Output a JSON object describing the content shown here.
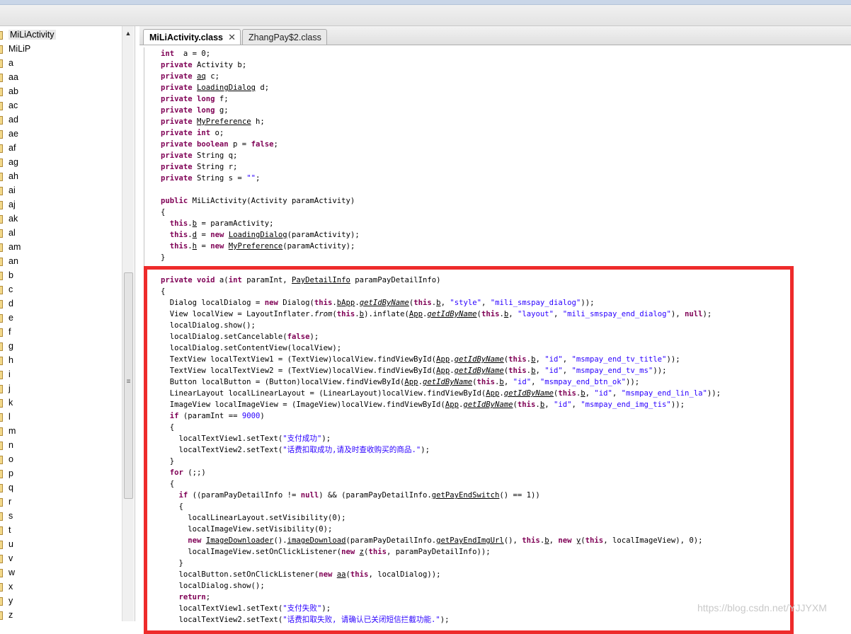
{
  "tree": {
    "items": [
      "MiLiActivity",
      "MiLiP",
      "a",
      "aa",
      "ab",
      "ac",
      "ad",
      "ae",
      "af",
      "ag",
      "ah",
      "ai",
      "aj",
      "ak",
      "al",
      "am",
      "an",
      "b",
      "c",
      "d",
      "e",
      "f",
      "g",
      "h",
      "i",
      "j",
      "k",
      "l",
      "m",
      "n",
      "o",
      "p",
      "q",
      "r",
      "s",
      "t",
      "u",
      "v",
      "w",
      "x",
      "y",
      "z"
    ],
    "selected": "MiLiActivity"
  },
  "tabs": [
    {
      "label": "MiLiActivity.class",
      "active": true
    },
    {
      "label": "ZhangPay$2.class",
      "active": false
    }
  ],
  "code_lines": [
    [
      [
        "kw",
        "int"
      ],
      [
        "",
        "  a = 0;"
      ]
    ],
    [
      [
        "kw",
        "private"
      ],
      [
        "",
        " Activity b;"
      ]
    ],
    [
      [
        "kw",
        "private"
      ],
      [
        "",
        " "
      ],
      [
        "ul",
        "aq"
      ],
      [
        "",
        " c;"
      ]
    ],
    [
      [
        "kw",
        "private"
      ],
      [
        "",
        " "
      ],
      [
        "ul",
        "LoadingDialog"
      ],
      [
        "",
        " d;"
      ]
    ],
    [
      [
        "kw",
        "private long"
      ],
      [
        "",
        " f;"
      ]
    ],
    [
      [
        "kw",
        "private long"
      ],
      [
        "",
        " g;"
      ]
    ],
    [
      [
        "kw",
        "private"
      ],
      [
        "",
        " "
      ],
      [
        "ul",
        "MyPreference"
      ],
      [
        "",
        " h;"
      ]
    ],
    [
      [
        "kw",
        "private int"
      ],
      [
        "",
        " o;"
      ]
    ],
    [
      [
        "kw",
        "private boolean"
      ],
      [
        "",
        " p = "
      ],
      [
        "kw",
        "false"
      ],
      [
        "",
        ";"
      ]
    ],
    [
      [
        "kw",
        "private"
      ],
      [
        "",
        " String q;"
      ]
    ],
    [
      [
        "kw",
        "private"
      ],
      [
        "",
        " String r;"
      ]
    ],
    [
      [
        "kw",
        "private"
      ],
      [
        "",
        " String s = "
      ],
      [
        "str",
        "\"\""
      ],
      [
        "",
        ";"
      ]
    ],
    [],
    [
      [
        "kw",
        "public"
      ],
      [
        "",
        " MiLiActivity(Activity paramActivity)"
      ]
    ],
    [
      [
        "",
        "{"
      ]
    ],
    [
      [
        "",
        "  "
      ],
      [
        "kw",
        "this"
      ],
      [
        "",
        "."
      ],
      [
        "ul",
        "b"
      ],
      [
        "",
        " = paramActivity;"
      ]
    ],
    [
      [
        "",
        "  "
      ],
      [
        "kw",
        "this"
      ],
      [
        "",
        "."
      ],
      [
        "ul",
        "d"
      ],
      [
        "",
        " = "
      ],
      [
        "kw",
        "new"
      ],
      [
        "",
        " "
      ],
      [
        "ul",
        "LoadingDialog"
      ],
      [
        "",
        "(paramActivity);"
      ]
    ],
    [
      [
        "",
        "  "
      ],
      [
        "kw",
        "this"
      ],
      [
        "",
        "."
      ],
      [
        "ul",
        "h"
      ],
      [
        "",
        " = "
      ],
      [
        "kw",
        "new"
      ],
      [
        "",
        " "
      ],
      [
        "ul",
        "MyPreference"
      ],
      [
        "",
        "(paramActivity);"
      ]
    ],
    [
      [
        "",
        "}"
      ]
    ],
    [],
    [
      [
        "kw",
        "private void"
      ],
      [
        "",
        " a("
      ],
      [
        "kw",
        "int"
      ],
      [
        "",
        " paramInt, "
      ],
      [
        "ul",
        "PayDetailInfo"
      ],
      [
        "",
        " paramPayDetailInfo)"
      ]
    ],
    [
      [
        "",
        "{"
      ]
    ],
    [
      [
        "",
        "  Dialog localDialog = "
      ],
      [
        "kw",
        "new"
      ],
      [
        "",
        " Dialog("
      ],
      [
        "kw",
        "this"
      ],
      [
        "",
        "."
      ],
      [
        "ul",
        "b"
      ],
      [
        ", "
      ],
      [
        "ul",
        "App"
      ],
      [
        "",
        "."
      ],
      [
        "ul it",
        "getIdByName"
      ],
      [
        "",
        "("
      ],
      [
        "kw",
        "this"
      ],
      [
        "",
        "."
      ],
      [
        "ul",
        "b"
      ],
      [
        "",
        ", "
      ],
      [
        "str",
        "\"style\""
      ],
      [
        "",
        ", "
      ],
      [
        "str",
        "\"mili_smspay_dialog\""
      ],
      [
        "",
        "));"
      ]
    ],
    [
      [
        "",
        "  View localView = LayoutInflater."
      ],
      [
        "it",
        "from"
      ],
      [
        "",
        "("
      ],
      [
        "kw",
        "this"
      ],
      [
        "",
        "."
      ],
      [
        "ul",
        "b"
      ],
      [
        "",
        ").inflate("
      ],
      [
        "ul",
        "App"
      ],
      [
        "",
        "."
      ],
      [
        "ul it",
        "getIdByName"
      ],
      [
        "",
        "("
      ],
      [
        "kw",
        "this"
      ],
      [
        "",
        "."
      ],
      [
        "ul",
        "b"
      ],
      [
        "",
        ", "
      ],
      [
        "str",
        "\"layout\""
      ],
      [
        "",
        ", "
      ],
      [
        "str",
        "\"mili_smspay_end_dialog\""
      ],
      [
        "",
        "), "
      ],
      [
        "kw",
        "null"
      ],
      [
        "",
        ");"
      ]
    ],
    [
      [
        "",
        "  localDialog.show();"
      ]
    ],
    [
      [
        "",
        "  localDialog.setCancelable("
      ],
      [
        "kw",
        "false"
      ],
      [
        "",
        ");"
      ]
    ],
    [
      [
        "",
        "  localDialog.setContentView(localView);"
      ]
    ],
    [
      [
        "",
        "  TextView localTextView1 = (TextView)localView.findViewById("
      ],
      [
        "ul",
        "App"
      ],
      [
        "",
        "."
      ],
      [
        "ul it",
        "getIdByName"
      ],
      [
        "",
        "("
      ],
      [
        "kw",
        "this"
      ],
      [
        "",
        "."
      ],
      [
        "ul",
        "b"
      ],
      [
        "",
        ", "
      ],
      [
        "str",
        "\"id\""
      ],
      [
        "",
        ", "
      ],
      [
        "str",
        "\"msmpay_end_tv_title\""
      ],
      [
        "",
        "));"
      ]
    ],
    [
      [
        "",
        "  TextView localTextView2 = (TextView)localView.findViewById("
      ],
      [
        "ul",
        "App"
      ],
      [
        "",
        "."
      ],
      [
        "ul it",
        "getIdByName"
      ],
      [
        "",
        "("
      ],
      [
        "kw",
        "this"
      ],
      [
        "",
        "."
      ],
      [
        "ul",
        "b"
      ],
      [
        "",
        ", "
      ],
      [
        "str",
        "\"id\""
      ],
      [
        "",
        ", "
      ],
      [
        "str",
        "\"msmpay_end_tv_ms\""
      ],
      [
        "",
        "));"
      ]
    ],
    [
      [
        "",
        "  Button localButton = (Button)localView.findViewById("
      ],
      [
        "ul",
        "App"
      ],
      [
        "",
        "."
      ],
      [
        "ul it",
        "getIdByName"
      ],
      [
        "",
        "("
      ],
      [
        "kw",
        "this"
      ],
      [
        "",
        "."
      ],
      [
        "ul",
        "b"
      ],
      [
        "",
        ", "
      ],
      [
        "str",
        "\"id\""
      ],
      [
        "",
        ", "
      ],
      [
        "str",
        "\"msmpay_end_btn_ok\""
      ],
      [
        "",
        "));"
      ]
    ],
    [
      [
        "",
        "  LinearLayout localLinearLayout = (LinearLayout)localView.findViewById("
      ],
      [
        "ul",
        "App"
      ],
      [
        "",
        "."
      ],
      [
        "ul it",
        "getIdByName"
      ],
      [
        "",
        "("
      ],
      [
        "kw",
        "this"
      ],
      [
        "",
        "."
      ],
      [
        "ul",
        "b"
      ],
      [
        "",
        ", "
      ],
      [
        "str",
        "\"id\""
      ],
      [
        "",
        ", "
      ],
      [
        "str",
        "\"msmpay_end_lin_la\""
      ],
      [
        "",
        "));"
      ]
    ],
    [
      [
        "",
        "  ImageView localImageView = (ImageView)localView.findViewById("
      ],
      [
        "ul",
        "App"
      ],
      [
        "",
        "."
      ],
      [
        "ul it",
        "getIdByName"
      ],
      [
        "",
        "("
      ],
      [
        "kw",
        "this"
      ],
      [
        "",
        "."
      ],
      [
        "ul",
        "b"
      ],
      [
        "",
        ", "
      ],
      [
        "str",
        "\"id\""
      ],
      [
        "",
        ", "
      ],
      [
        "str",
        "\"msmpay_end_img_tis\""
      ],
      [
        "",
        "));"
      ]
    ],
    [
      [
        "",
        "  "
      ],
      [
        "kw",
        "if"
      ],
      [
        "",
        " (paramInt == "
      ],
      [
        "str",
        "9000"
      ],
      [
        "",
        ")"
      ]
    ],
    [
      [
        "",
        "  {"
      ]
    ],
    [
      [
        "",
        "    localTextView1.setText("
      ],
      [
        "str",
        "\"支付成功\""
      ],
      [
        "",
        ");"
      ]
    ],
    [
      [
        "",
        "    localTextView2.setText("
      ],
      [
        "str",
        "\"话费扣取成功,请及时查收购买的商品.\""
      ],
      [
        "",
        ");"
      ]
    ],
    [
      [
        "",
        "  }"
      ]
    ],
    [
      [
        "",
        "  "
      ],
      [
        "kw",
        "for"
      ],
      [
        "",
        " (;;)"
      ]
    ],
    [
      [
        "",
        "  {"
      ]
    ],
    [
      [
        "",
        "    "
      ],
      [
        "kw",
        "if"
      ],
      [
        "",
        " ((paramPayDetailInfo != "
      ],
      [
        "kw",
        "null"
      ],
      [
        "",
        ") && (paramPayDetailInfo."
      ],
      [
        "ul",
        "getPayEndSwitch"
      ],
      [
        "",
        "() == 1))"
      ]
    ],
    [
      [
        "",
        "    {"
      ]
    ],
    [
      [
        "",
        "      localLinearLayout.setVisibility(0);"
      ]
    ],
    [
      [
        "",
        "      localImageView.setVisibility(0);"
      ]
    ],
    [
      [
        "",
        "      "
      ],
      [
        "kw",
        "new"
      ],
      [
        "",
        " "
      ],
      [
        "ul",
        "ImageDownloader"
      ],
      [
        "",
        "()."
      ],
      [
        "ul",
        "imageDownload"
      ],
      [
        "",
        "(paramPayDetailInfo."
      ],
      [
        "ul",
        "getPayEndImgUrl"
      ],
      [
        "",
        "(), "
      ],
      [
        "kw",
        "this"
      ],
      [
        "",
        "."
      ],
      [
        "ul",
        "b"
      ],
      [
        "",
        ", "
      ],
      [
        "kw",
        "new"
      ],
      [
        "",
        " "
      ],
      [
        "ul",
        "y"
      ],
      [
        "",
        "("
      ],
      [
        "kw",
        "this"
      ],
      [
        "",
        ", localImageView), 0);"
      ]
    ],
    [
      [
        "",
        "      localImageView.setOnClickListener("
      ],
      [
        "kw",
        "new"
      ],
      [
        "",
        " "
      ],
      [
        "ul",
        "z"
      ],
      [
        "",
        "("
      ],
      [
        "kw",
        "this"
      ],
      [
        "",
        ", paramPayDetailInfo));"
      ]
    ],
    [
      [
        "",
        "    }"
      ]
    ],
    [
      [
        "",
        "    localButton.setOnClickListener("
      ],
      [
        "kw",
        "new"
      ],
      [
        "",
        " "
      ],
      [
        "ul",
        "aa"
      ],
      [
        "",
        "("
      ],
      [
        "kw",
        "this"
      ],
      [
        "",
        ", localDialog));"
      ]
    ],
    [
      [
        "",
        "    localDialog.show();"
      ]
    ],
    [
      [
        "",
        "    "
      ],
      [
        "kw",
        "return"
      ],
      [
        "",
        ";"
      ]
    ],
    [
      [
        "",
        "    localTextView1.setText("
      ],
      [
        "str",
        "\"支付失败\""
      ],
      [
        "",
        ");"
      ]
    ],
    [
      [
        "",
        "    localTextView2.setText("
      ],
      [
        "str",
        "\"话费扣取失败, 请确认已关闭短信拦截功能.\""
      ],
      [
        "",
        ");"
      ]
    ]
  ],
  "watermark": "https://blog.csdn.net/YJJYXM",
  "colors": {
    "keyword": "#7f0055",
    "string": "#2a00ff",
    "highlight_box": "#ee2b2b"
  }
}
